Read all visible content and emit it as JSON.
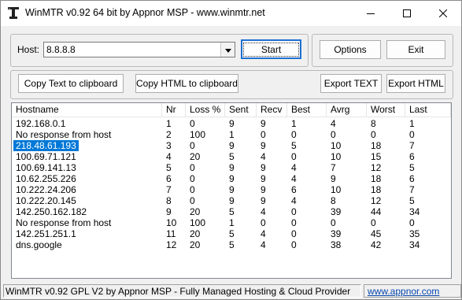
{
  "window": {
    "title": "WinMTR v0.92 64 bit by Appnor MSP - www.winmtr.net"
  },
  "icons": {
    "app": "app-icon",
    "minimize": "minimize-icon",
    "maximize": "maximize-icon",
    "close": "close-icon",
    "combo_arrow": "chevron-down-icon"
  },
  "host": {
    "label": "Host:",
    "value": "8.8.8.8"
  },
  "buttons": {
    "start": "Start",
    "options": "Options",
    "exit": "Exit",
    "copy_text": "Copy Text to clipboard",
    "copy_html": "Copy HTML to clipboard",
    "export_text": "Export TEXT",
    "export_html": "Export HTML"
  },
  "table": {
    "columns": [
      "Hostname",
      "Nr",
      "Loss %",
      "Sent",
      "Recv",
      "Best",
      "Avrg",
      "Worst",
      "Last"
    ],
    "rows": [
      [
        "192.168.0.1",
        "1",
        "0",
        "9",
        "9",
        "1",
        "4",
        "8",
        "1"
      ],
      [
        "No response from host",
        "2",
        "100",
        "1",
        "0",
        "0",
        "0",
        "0",
        "0"
      ],
      [
        "218.48.61.193",
        "3",
        "0",
        "9",
        "9",
        "5",
        "10",
        "18",
        "7"
      ],
      [
        "100.69.71.121",
        "4",
        "20",
        "5",
        "4",
        "0",
        "10",
        "15",
        "6"
      ],
      [
        "100.69.141.13",
        "5",
        "0",
        "9",
        "9",
        "4",
        "7",
        "12",
        "5"
      ],
      [
        "10.62.255.226",
        "6",
        "0",
        "9",
        "9",
        "4",
        "9",
        "18",
        "6"
      ],
      [
        "10.222.24.206",
        "7",
        "0",
        "9",
        "9",
        "6",
        "10",
        "18",
        "7"
      ],
      [
        "10.222.20.145",
        "8",
        "0",
        "9",
        "9",
        "4",
        "8",
        "12",
        "5"
      ],
      [
        "142.250.162.182",
        "9",
        "20",
        "5",
        "4",
        "0",
        "39",
        "44",
        "34"
      ],
      [
        "No response from host",
        "10",
        "100",
        "1",
        "0",
        "0",
        "0",
        "0",
        "0"
      ],
      [
        "142.251.251.1",
        "11",
        "20",
        "5",
        "4",
        "0",
        "39",
        "45",
        "35"
      ],
      [
        "dns.google",
        "12",
        "20",
        "5",
        "4",
        "0",
        "38",
        "42",
        "34"
      ]
    ],
    "selected_row": 2
  },
  "status": {
    "text": "WinMTR v0.92 GPL V2 by Appnor MSP - Fully Managed Hosting & Cloud Provider",
    "link": "www.appnor.com"
  }
}
